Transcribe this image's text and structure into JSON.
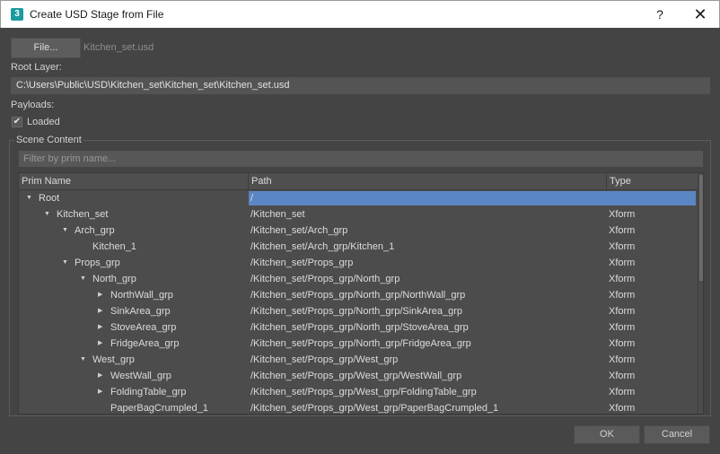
{
  "window": {
    "title": "Create USD Stage from File",
    "icon_text": "3",
    "help_label": "?",
    "close_label": "✕"
  },
  "file": {
    "button_label": "File...",
    "file_name": "Kitchen_set.usd"
  },
  "root_layer": {
    "label": "Root Layer:",
    "path": "C:\\Users\\Public\\USD\\Kitchen_set\\Kitchen_set\\Kitchen_set.usd"
  },
  "payloads": {
    "label": "Payloads:",
    "loaded_label": "Loaded",
    "loaded_checked": true
  },
  "scene_content": {
    "title": "Scene Content",
    "filter_placeholder": "Filter by prim name...",
    "columns": [
      "Prim Name",
      "Path",
      "Type"
    ],
    "rows": [
      {
        "name": "Root",
        "path": "/",
        "type": "",
        "depth": 0,
        "expander": "expanded",
        "selected": true
      },
      {
        "name": "Kitchen_set",
        "path": "/Kitchen_set",
        "type": "Xform",
        "depth": 1,
        "expander": "expanded"
      },
      {
        "name": "Arch_grp",
        "path": "/Kitchen_set/Arch_grp",
        "type": "Xform",
        "depth": 2,
        "expander": "expanded"
      },
      {
        "name": "Kitchen_1",
        "path": "/Kitchen_set/Arch_grp/Kitchen_1",
        "type": "Xform",
        "depth": 3,
        "expander": "none"
      },
      {
        "name": "Props_grp",
        "path": "/Kitchen_set/Props_grp",
        "type": "Xform",
        "depth": 2,
        "expander": "expanded"
      },
      {
        "name": "North_grp",
        "path": "/Kitchen_set/Props_grp/North_grp",
        "type": "Xform",
        "depth": 3,
        "expander": "expanded"
      },
      {
        "name": "NorthWall_grp",
        "path": "/Kitchen_set/Props_grp/North_grp/NorthWall_grp",
        "type": "Xform",
        "depth": 4,
        "expander": "collapsed"
      },
      {
        "name": "SinkArea_grp",
        "path": "/Kitchen_set/Props_grp/North_grp/SinkArea_grp",
        "type": "Xform",
        "depth": 4,
        "expander": "collapsed"
      },
      {
        "name": "StoveArea_grp",
        "path": "/Kitchen_set/Props_grp/North_grp/StoveArea_grp",
        "type": "Xform",
        "depth": 4,
        "expander": "collapsed"
      },
      {
        "name": "FridgeArea_grp",
        "path": "/Kitchen_set/Props_grp/North_grp/FridgeArea_grp",
        "type": "Xform",
        "depth": 4,
        "expander": "collapsed"
      },
      {
        "name": "West_grp",
        "path": "/Kitchen_set/Props_grp/West_grp",
        "type": "Xform",
        "depth": 3,
        "expander": "expanded"
      },
      {
        "name": "WestWall_grp",
        "path": "/Kitchen_set/Props_grp/West_grp/WestWall_grp",
        "type": "Xform",
        "depth": 4,
        "expander": "collapsed"
      },
      {
        "name": "FoldingTable_grp",
        "path": "/Kitchen_set/Props_grp/West_grp/FoldingTable_grp",
        "type": "Xform",
        "depth": 4,
        "expander": "collapsed"
      },
      {
        "name": "PaperBagCrumpled_1",
        "path": "/Kitchen_set/Props_grp/West_grp/PaperBagCrumpled_1",
        "type": "Xform",
        "depth": 4,
        "expander": "none"
      }
    ]
  },
  "buttons": {
    "ok": "OK",
    "cancel": "Cancel"
  },
  "colors": {
    "selection": "#5b86c4",
    "background": "#444444",
    "app_icon": "#1b9ba0"
  }
}
